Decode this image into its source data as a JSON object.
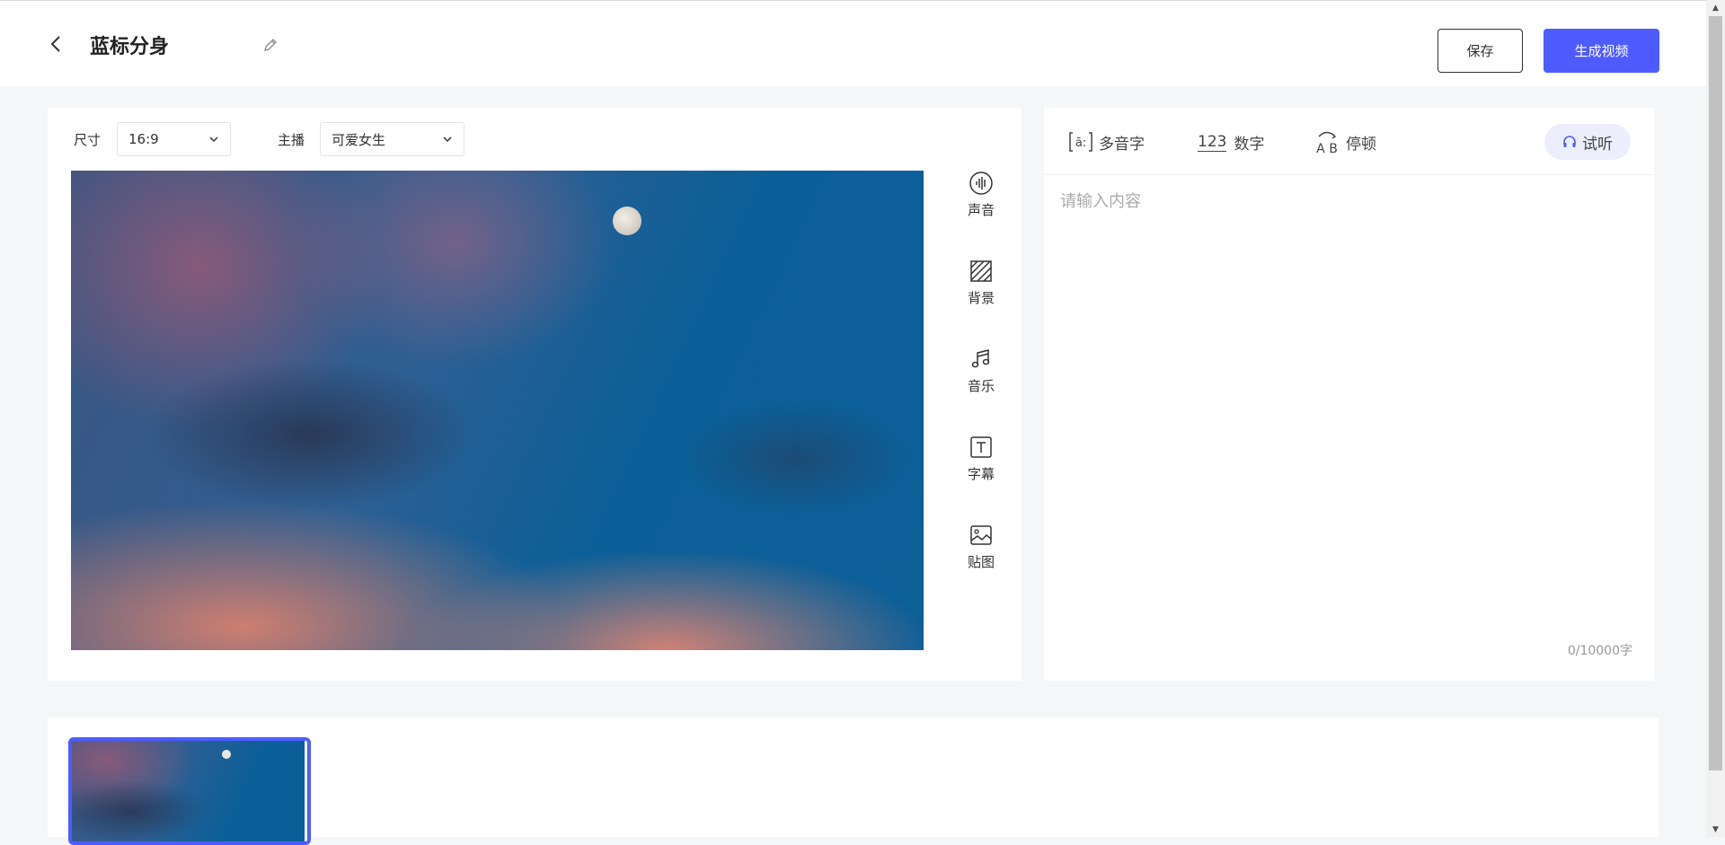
{
  "header": {
    "title": "蓝标分身",
    "save_label": "保存",
    "generate_label": "生成视频"
  },
  "editor": {
    "size_label": "尺寸",
    "size_value": "16:9",
    "host_label": "主播",
    "host_value": "可爱女生",
    "tools": [
      {
        "label": "声音",
        "icon": "voice-icon"
      },
      {
        "label": "背景",
        "icon": "background-icon"
      },
      {
        "label": "音乐",
        "icon": "music-icon"
      },
      {
        "label": "字幕",
        "icon": "subtitle-icon"
      },
      {
        "label": "贴图",
        "icon": "sticker-icon"
      }
    ]
  },
  "script_panel": {
    "polyphone_label": "多音字",
    "number_icon_text": "123",
    "number_label": "数字",
    "pause_label": "停顿",
    "listen_label": "试听",
    "placeholder": "请输入内容",
    "counter": "0/10000字"
  },
  "colors": {
    "accent": "#4e5cff",
    "listen_bg": "#eceefc"
  }
}
